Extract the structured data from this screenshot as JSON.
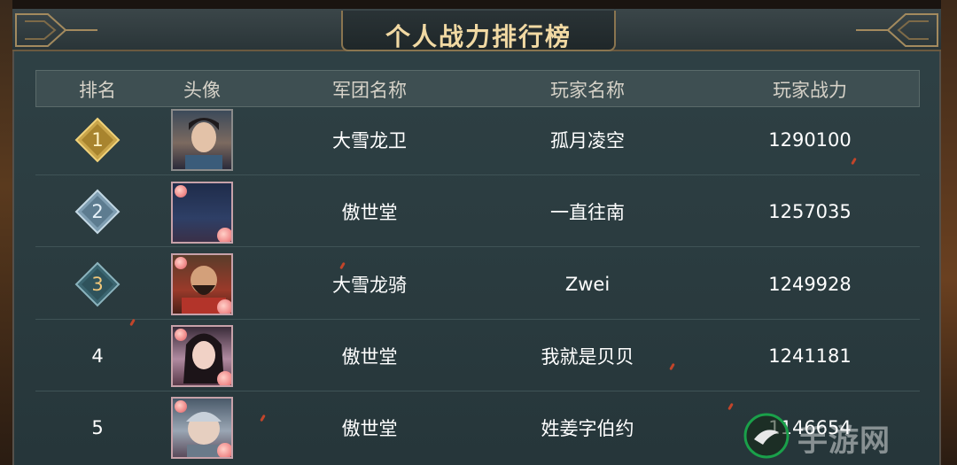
{
  "title": "个人战力排行榜",
  "headers": {
    "rank": "排名",
    "avatar": "头像",
    "guild": "军团名称",
    "player": "玩家名称",
    "power": "玩家战力"
  },
  "rows": [
    {
      "rank": "1",
      "guild": "大雪龙卫",
      "player": "孤月凌空",
      "power": "1290100",
      "badge_color": "#c9a54a",
      "avatar_icon": "male-warrior-portrait"
    },
    {
      "rank": "2",
      "guild": "傲世堂",
      "player": "一直往南",
      "power": "1257035",
      "badge_color": "#7f9eb2",
      "avatar_icon": "night-scene-portrait"
    },
    {
      "rank": "3",
      "guild": "大雪龙骑",
      "player": "Zwei",
      "power": "1249928",
      "badge_color": "#4d7b86",
      "avatar_icon": "bearded-general-portrait"
    },
    {
      "rank": "4",
      "guild": "傲世堂",
      "player": "我就是贝贝",
      "power": "1241181",
      "avatar_icon": "female-portrait"
    },
    {
      "rank": "5",
      "guild": "傲世堂",
      "player": "姓姜字伯约",
      "power": "1146654",
      "avatar_icon": "chibi-armored-portrait"
    }
  ],
  "watermark": "手游网"
}
